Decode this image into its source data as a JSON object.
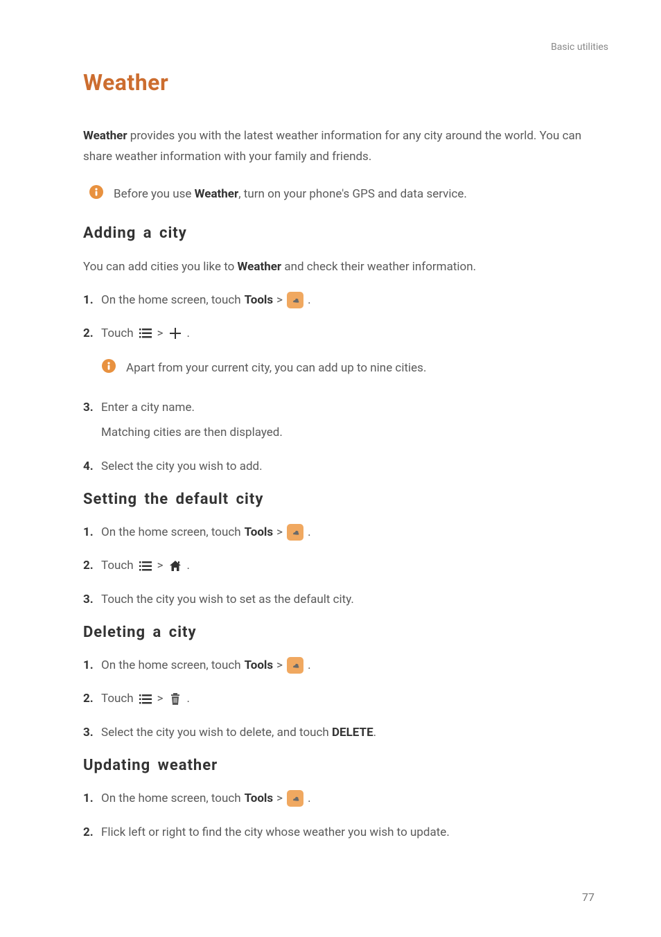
{
  "header": {
    "breadcrumb": "Basic utilities"
  },
  "section": {
    "title": "Weather"
  },
  "intro": {
    "line1_part1": "Weather",
    "line1_part2": " provides you with the latest weather information for any city around the world. You can share weather information with your family and friends."
  },
  "callout_gps": {
    "pre": "Before you use ",
    "bold": "Weather",
    "post": ", turn on your phone's GPS and data service."
  },
  "adding": {
    "title": "Adding a city",
    "intro_pre": "You can add cities you like to ",
    "intro_bold": "Weather",
    "intro_post": " and check their weather information.",
    "step1_pre": "On the home screen, touch ",
    "step1_bold": "Tools",
    "step1_gt": " > ",
    "step1_post": " .",
    "step2_pre": "Touch ",
    "step2_mid": " > ",
    "step2_post": " .",
    "callout_nine": "Apart from your current city, you can add up to nine cities.",
    "step3_line1": "Enter a city name.",
    "step3_line2": "Matching cities are then displayed.",
    "step4": "Select the city you wish to add."
  },
  "default_city": {
    "title": "Setting the default city",
    "step1_pre": "On the home screen, touch ",
    "step1_bold": "Tools",
    "step1_gt": " > ",
    "step1_post": " .",
    "step2_pre": "Touch ",
    "step2_mid": " > ",
    "step2_post": " .",
    "step3": "Touch the city you wish to set as the default city."
  },
  "deleting": {
    "title": "Deleting a city",
    "step1_pre": "On the home screen, touch ",
    "step1_bold": "Tools",
    "step1_gt": " > ",
    "step1_post": " .",
    "step2_pre": "Touch ",
    "step2_mid": " > ",
    "step2_post": " .",
    "step3_pre": "Select the city you wish to delete, and touch ",
    "step3_bold": "DELETE",
    "step3_post": "."
  },
  "updating": {
    "title": "Updating weather",
    "step1_pre": "On the home screen, touch ",
    "step1_bold": "Tools",
    "step1_gt": " > ",
    "step1_post": " .",
    "step2": "Flick left or right to find the city whose weather you wish to update."
  },
  "page_number": "77"
}
